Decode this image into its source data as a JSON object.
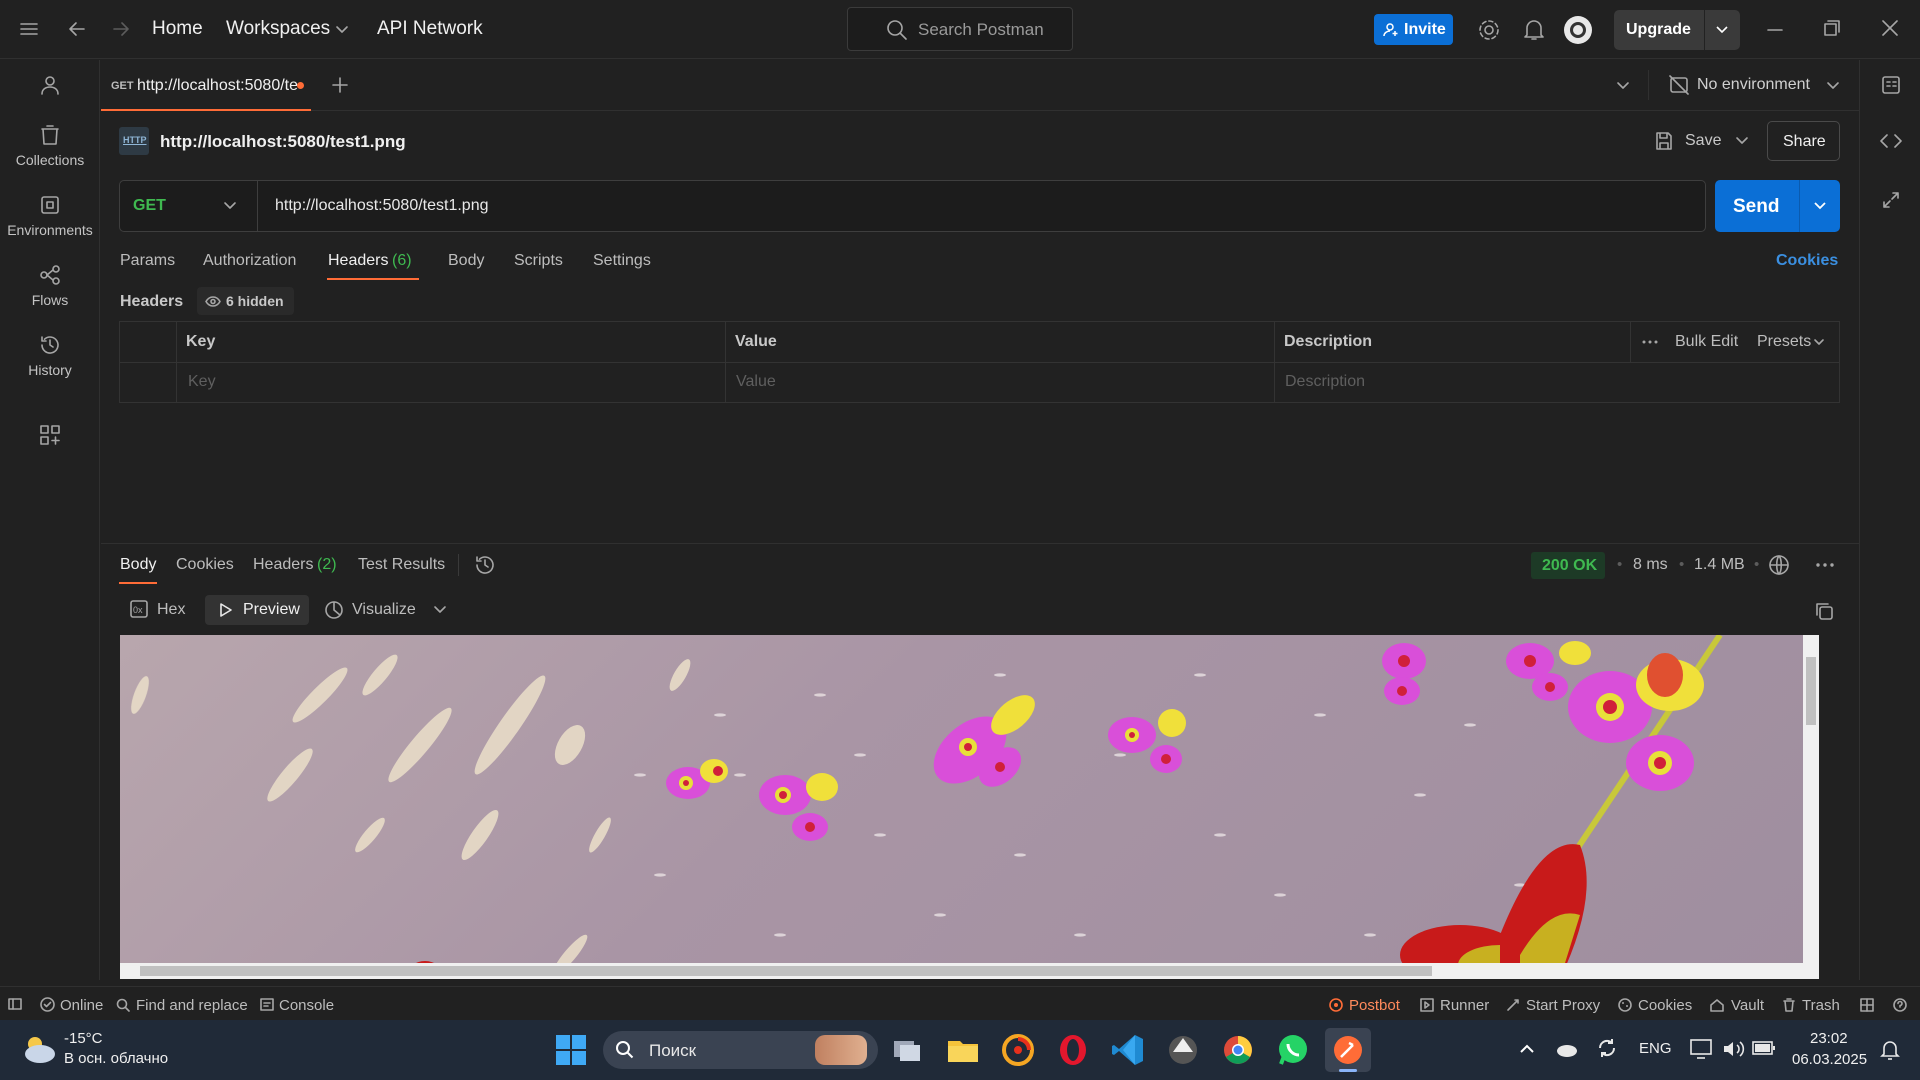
{
  "titlebar": {
    "home": "Home",
    "workspaces": "Workspaces",
    "api_network": "API Network",
    "search_placeholder": "Search Postman",
    "invite": "Invite",
    "upgrade": "Upgrade"
  },
  "sidebar": {
    "items": [
      {
        "label": "Collections"
      },
      {
        "label": "Environments"
      },
      {
        "label": "Flows"
      },
      {
        "label": "History"
      }
    ]
  },
  "tabbar": {
    "tab_method": "GET",
    "tab_title": "http://localhost:5080/te",
    "environment": "No environment"
  },
  "request": {
    "name": "http://localhost:5080/test1.png",
    "save": "Save",
    "share": "Share",
    "method": "GET",
    "url": "http://localhost:5080/test1.png",
    "send": "Send",
    "tabs": [
      "Params",
      "Authorization",
      "Headers",
      "Body",
      "Scripts",
      "Settings"
    ],
    "headers_count": "(6)",
    "cookies": "Cookies",
    "headers_label": "Headers",
    "hidden": "6 hidden",
    "table": {
      "columns": [
        "Key",
        "Value",
        "Description"
      ],
      "placeholders": [
        "Key",
        "Value",
        "Description"
      ],
      "bulk_edit": "Bulk Edit",
      "presets": "Presets"
    }
  },
  "response": {
    "tabs": [
      "Body",
      "Cookies",
      "Headers",
      "Test Results"
    ],
    "headers_count": "(2)",
    "status": "200 OK",
    "time": "8 ms",
    "size": "1.4 MB",
    "view_modes": [
      "Hex",
      "Preview",
      "Visualize"
    ]
  },
  "statusbar": {
    "online": "Online",
    "find_replace": "Find and replace",
    "console": "Console",
    "postbot": "Postbot",
    "runner": "Runner",
    "start_proxy": "Start Proxy",
    "cookies": "Cookies",
    "vault": "Vault",
    "trash": "Trash"
  },
  "taskbar": {
    "temperature": "-15°C",
    "weather": "В осн. облачно",
    "search": "Поиск",
    "lang": "ENG",
    "time": "23:02",
    "date": "06.03.2025"
  },
  "colors": {
    "accent_blue": "#0b6fd6",
    "status_green": "#3fb950",
    "postbot_orange": "#ff6c37",
    "tab_underline": "#ff6c37"
  }
}
